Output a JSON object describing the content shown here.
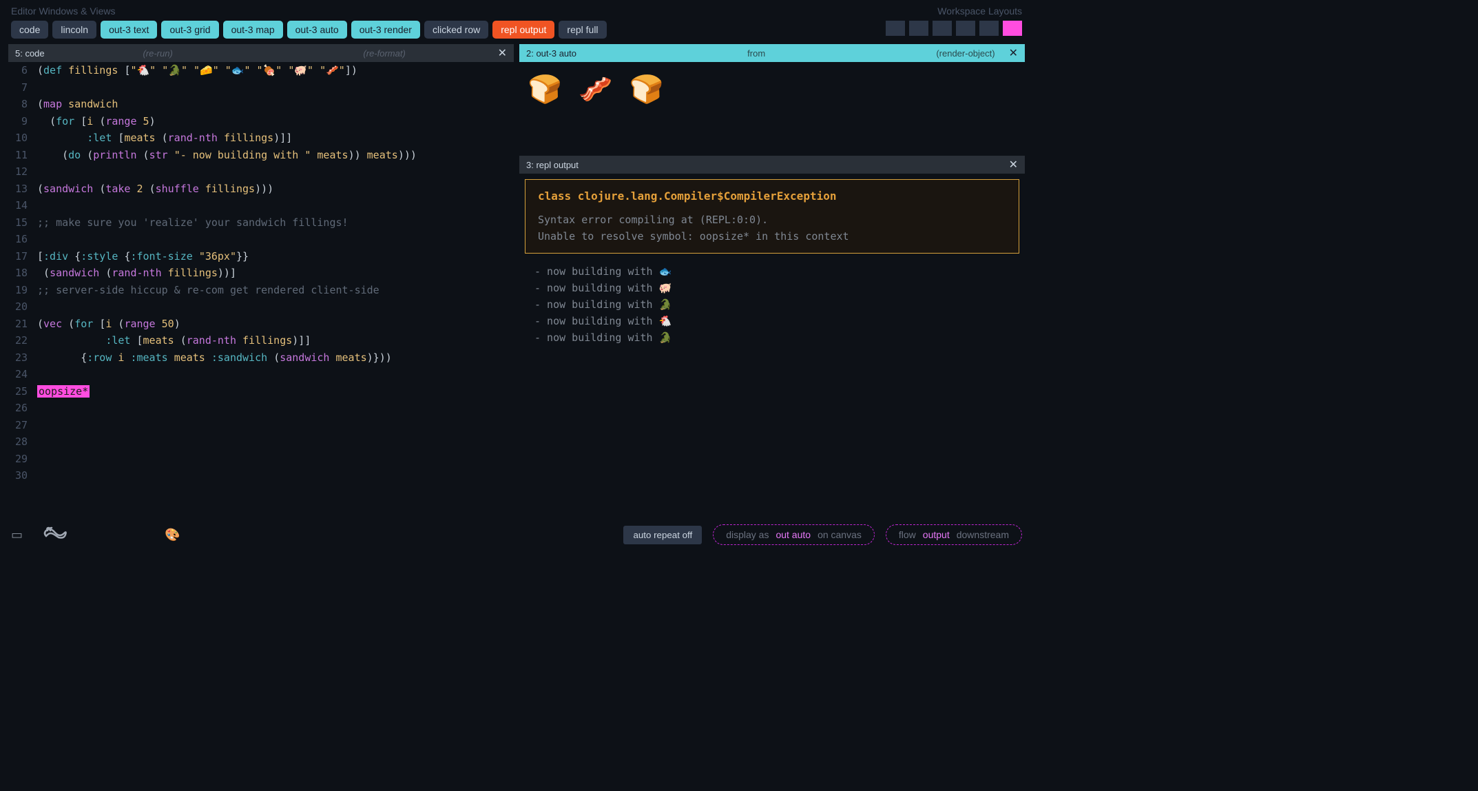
{
  "header": {
    "left_title": "Editor Windows & Views",
    "right_title": "Workspace Layouts"
  },
  "tabs": [
    {
      "label": "code",
      "variant": "default"
    },
    {
      "label": "lincoln",
      "variant": "default"
    },
    {
      "label": "out-3 text",
      "variant": "cyan"
    },
    {
      "label": "out-3 grid",
      "variant": "cyan"
    },
    {
      "label": "out-3 map",
      "variant": "cyan"
    },
    {
      "label": "out-3 auto",
      "variant": "cyan"
    },
    {
      "label": "out-3 render",
      "variant": "cyan"
    },
    {
      "label": "clicked row",
      "variant": "default"
    },
    {
      "label": "repl output",
      "variant": "orange"
    },
    {
      "label": "repl full",
      "variant": "default"
    }
  ],
  "code_pane": {
    "title": "5: code",
    "action1": "(re-run)",
    "action2": "(re-format)"
  },
  "code_lines": [
    {
      "n": 6,
      "html": "<span class='tok-paren'>(</span><span class='tok-kw'>def</span> <span class='tok-sym'>fillings</span> <span class='tok-paren'>[</span><span class='tok-str'>\"🐔\" \"🐊\" \"🧀\" \"🐟\" \"🍖\" \"🐖\" \"🥓\"</span><span class='tok-paren'>])</span>"
    },
    {
      "n": 7,
      "html": ""
    },
    {
      "n": 8,
      "html": "<span class='tok-paren'>(</span><span class='tok-fn'>map</span> <span class='tok-sym'>sandwich</span>"
    },
    {
      "n": 9,
      "html": "  <span class='tok-paren'>(</span><span class='tok-kw'>for</span> <span class='tok-paren'>[</span><span class='tok-sym'>i</span> <span class='tok-paren'>(</span><span class='tok-fn'>range</span> <span class='tok-num'>5</span><span class='tok-paren'>)</span>"
    },
    {
      "n": 10,
      "html": "        <span class='tok-key'>:let</span> <span class='tok-paren'>[</span><span class='tok-sym'>meats</span> <span class='tok-paren'>(</span><span class='tok-fn'>rand-nth</span> <span class='tok-sym'>fillings</span><span class='tok-paren'>)]]</span>"
    },
    {
      "n": 11,
      "html": "    <span class='tok-paren'>(</span><span class='tok-kw'>do</span> <span class='tok-paren'>(</span><span class='tok-fn'>println</span> <span class='tok-paren'>(</span><span class='tok-fn'>str</span> <span class='tok-str'>\"- now building with \"</span> <span class='tok-sym'>meats</span><span class='tok-paren'>))</span> <span class='tok-sym'>meats</span><span class='tok-paren'>)))</span>"
    },
    {
      "n": 12,
      "html": ""
    },
    {
      "n": 13,
      "html": "<span class='tok-paren'>(</span><span class='tok-fn'>sandwich</span> <span class='tok-paren'>(</span><span class='tok-fn'>take</span> <span class='tok-num'>2</span> <span class='tok-paren'>(</span><span class='tok-fn'>shuffle</span> <span class='tok-sym'>fillings</span><span class='tok-paren'>)))</span>"
    },
    {
      "n": 14,
      "html": ""
    },
    {
      "n": 15,
      "html": "<span class='tok-comment'>;; make sure you 'realize' your sandwich fillings!</span>"
    },
    {
      "n": 16,
      "html": ""
    },
    {
      "n": 17,
      "html": "<span class='tok-paren'>[</span><span class='tok-key'>:div</span> <span class='tok-paren'>{</span><span class='tok-key'>:style</span> <span class='tok-paren'>{</span><span class='tok-key'>:font-size</span> <span class='tok-str'>\"36px\"</span><span class='tok-paren'>}}</span>"
    },
    {
      "n": 18,
      "html": " <span class='tok-paren'>(</span><span class='tok-fn'>sandwich</span> <span class='tok-paren'>(</span><span class='tok-fn'>rand-nth</span> <span class='tok-sym'>fillings</span><span class='tok-paren'>))]</span>"
    },
    {
      "n": 19,
      "html": "<span class='tok-comment'>;; server-side hiccup & re-com get rendered client-side</span>"
    },
    {
      "n": 20,
      "html": ""
    },
    {
      "n": 21,
      "html": "<span class='tok-paren'>(</span><span class='tok-fn'>vec</span> <span class='tok-paren'>(</span><span class='tok-kw'>for</span> <span class='tok-paren'>[</span><span class='tok-sym'>i</span> <span class='tok-paren'>(</span><span class='tok-fn'>range</span> <span class='tok-num'>50</span><span class='tok-paren'>)</span>"
    },
    {
      "n": 22,
      "html": "           <span class='tok-key'>:let</span> <span class='tok-paren'>[</span><span class='tok-sym'>meats</span> <span class='tok-paren'>(</span><span class='tok-fn'>rand-nth</span> <span class='tok-sym'>fillings</span><span class='tok-paren'>)]]</span>"
    },
    {
      "n": 23,
      "html": "       <span class='tok-paren'>{</span><span class='tok-key'>:row</span> <span class='tok-sym'>i</span> <span class='tok-key'>:meats</span> <span class='tok-sym'>meats</span> <span class='tok-key'>:sandwich</span> <span class='tok-paren'>(</span><span class='tok-fn'>sandwich</span> <span class='tok-sym'>meats</span><span class='tok-paren'>)}))</span>"
    },
    {
      "n": 24,
      "html": ""
    },
    {
      "n": 25,
      "html": "<span class='tok-err'>oopsize*</span>"
    },
    {
      "n": 26,
      "html": ""
    },
    {
      "n": 27,
      "html": ""
    },
    {
      "n": 28,
      "html": ""
    },
    {
      "n": 29,
      "html": ""
    },
    {
      "n": 30,
      "html": ""
    }
  ],
  "render_pane": {
    "title": "2: out-3 auto",
    "sub1": "from",
    "sub2": "(render-object)",
    "emoji_output": "🍞 🥓 🍞"
  },
  "repl_pane": {
    "title": "3: repl output",
    "error_title": "class clojure.lang.Compiler$CompilerException",
    "error_line1": "Syntax error compiling at (REPL:0:0).",
    "error_line2": "Unable to resolve symbol: oopsize* in this context",
    "logs": [
      "- now building with 🐟",
      "- now building with 🐖",
      "- now building with 🐊",
      "- now building with 🐔",
      "- now building with 🐊"
    ]
  },
  "bottom": {
    "auto_repeat": "auto repeat off",
    "pill1_a": "display as",
    "pill1_b": "out auto",
    "pill1_c": "on canvas",
    "pill2_a": "flow",
    "pill2_b": "output",
    "pill2_c": "downstream"
  }
}
